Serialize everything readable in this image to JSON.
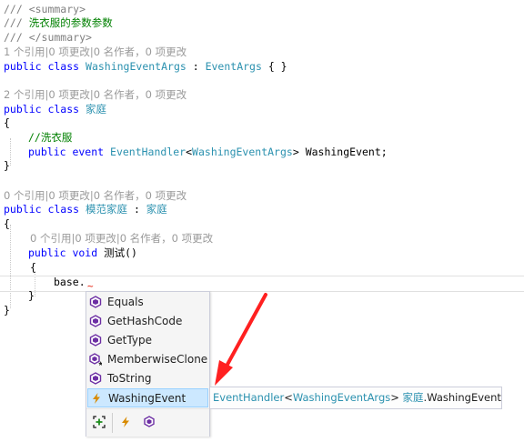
{
  "code": {
    "l1": "/// <summary>",
    "l2_prefix": "/// ",
    "l2_text": "洗衣服的参数参数",
    "l3": "/// </summary>",
    "lens1": "1 个引用|0 项更改|0 名作者，0 项更改",
    "l4_kw": "public class ",
    "l4_type": "WashingEventArgs",
    "l4_sep": " : ",
    "l4_base": "EventArgs",
    "l4_end": " { }",
    "lens2": "2 个引用|0 项更改|0 名作者，0 项更改",
    "l5_kw": "public class ",
    "l5_type": "家庭",
    "brace_open": "{",
    "l6_comment": "//洗衣服",
    "l7_kw": "public event ",
    "l7_type": "EventHandler",
    "l7_lt": "<",
    "l7_arg": "WashingEventArgs",
    "l7_gt": ">",
    "l7_name": " WashingEvent;",
    "brace_close": "}",
    "lens3": "0 个引用|0 项更改|0 名作者，0 项更改",
    "l8_kw": "public class ",
    "l8_type": "模范家庭",
    "l8_sep": " : ",
    "l8_base": "家庭",
    "lens4": "0 个引用|0 项更改|0 名作者，0 项更改",
    "l9_kw": "public void ",
    "l9_name": "测试()",
    "l10": "base.",
    "squiggle": "~"
  },
  "completion": {
    "items": [
      {
        "label": "Equals",
        "icon": "method-icon"
      },
      {
        "label": "GetHashCode",
        "icon": "method-icon"
      },
      {
        "label": "GetType",
        "icon": "method-icon"
      },
      {
        "label": "MemberwiseClone",
        "icon": "protected-method-icon"
      },
      {
        "label": "ToString",
        "icon": "method-icon"
      },
      {
        "label": "WashingEvent",
        "icon": "event-icon"
      }
    ],
    "selected_index": 5,
    "footer_icons": [
      "expand-filter-icon",
      "event-filter-icon",
      "method-filter-icon"
    ]
  },
  "tooltip": {
    "type": "EventHandler",
    "lt": "<",
    "arg": "WashingEventArgs",
    "gt": ">",
    "owner": " 家庭",
    "member": ".WashingEvent"
  },
  "colors": {
    "keyword": "#0000ff",
    "type": "#2b91af",
    "comment": "#008000",
    "selection": "#cce8ff",
    "method_icon": "#6c2ea3",
    "event_icon": "#d88a00",
    "annotation_arrow": "#ff2020"
  }
}
